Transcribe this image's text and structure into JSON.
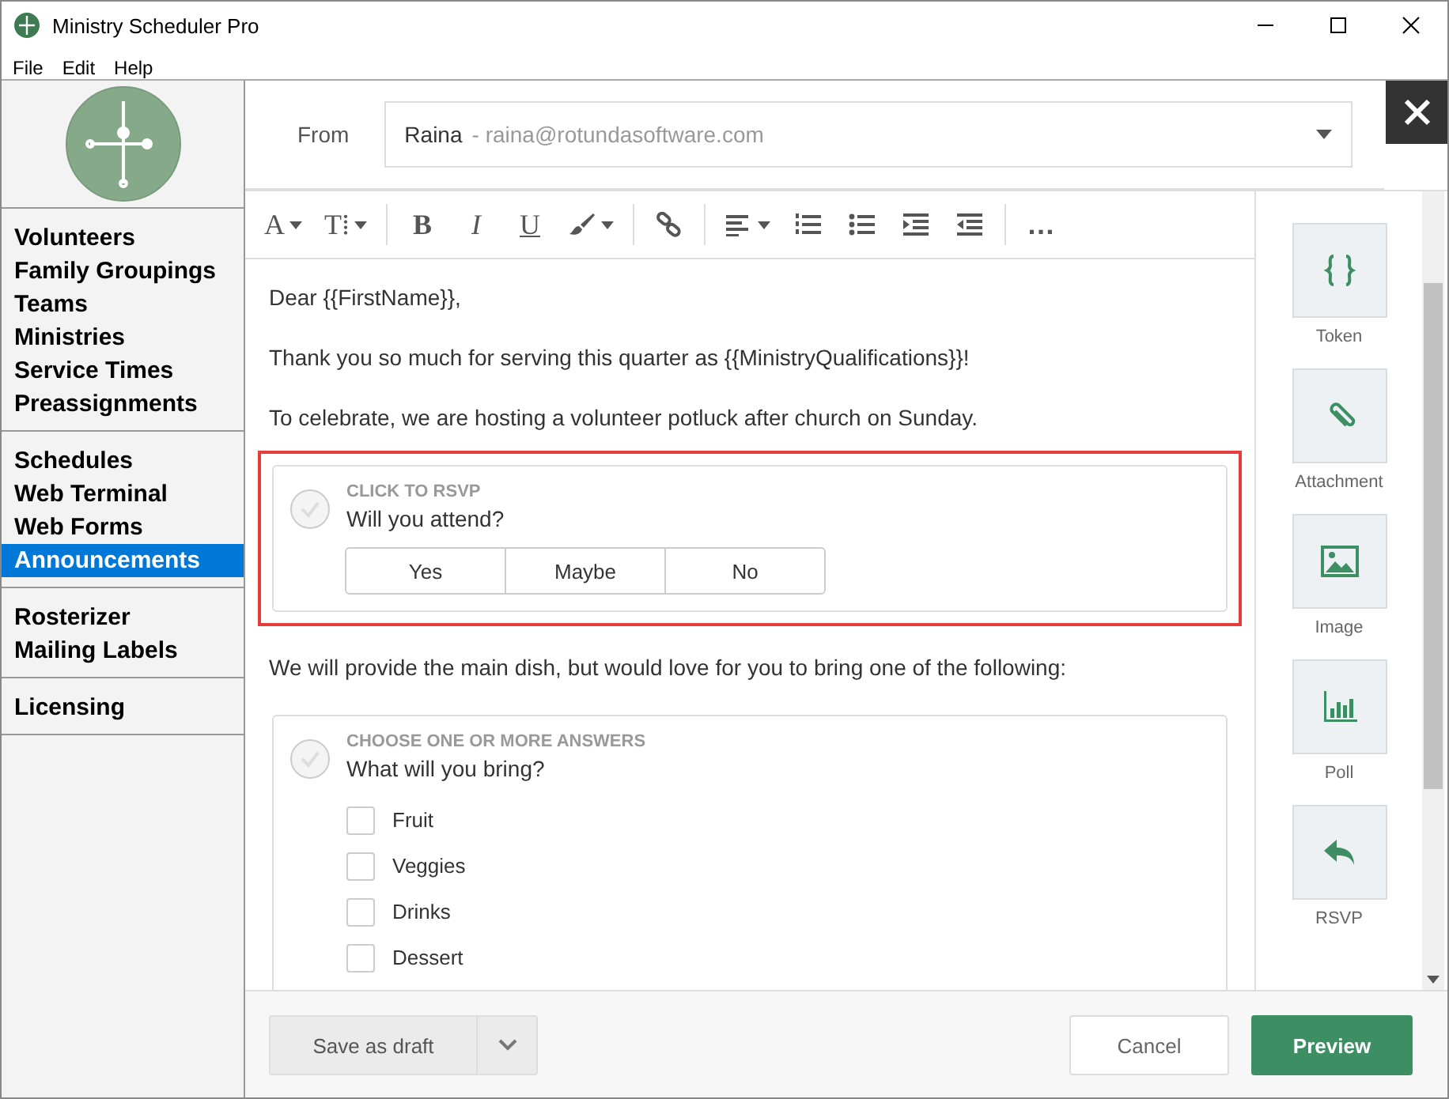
{
  "window": {
    "title": "Ministry Scheduler Pro"
  },
  "menu": [
    "File",
    "Edit",
    "Help"
  ],
  "sidebar": {
    "groups": [
      {
        "items": [
          {
            "label": "Volunteers",
            "selected": false
          },
          {
            "label": "Family Groupings",
            "selected": false
          },
          {
            "label": "Teams",
            "selected": false
          },
          {
            "label": "Ministries",
            "selected": false
          },
          {
            "label": "Service Times",
            "selected": false
          },
          {
            "label": "Preassignments",
            "selected": false
          }
        ]
      },
      {
        "items": [
          {
            "label": "Schedules",
            "selected": false
          },
          {
            "label": "Web Terminal",
            "selected": false
          },
          {
            "label": "Web Forms",
            "selected": false
          },
          {
            "label": "Announcements",
            "selected": true
          }
        ]
      },
      {
        "items": [
          {
            "label": "Rosterizer",
            "selected": false
          },
          {
            "label": "Mailing Labels",
            "selected": false
          }
        ]
      },
      {
        "items": [
          {
            "label": "Licensing",
            "selected": false
          }
        ]
      }
    ]
  },
  "from": {
    "label": "From",
    "name": "Raina",
    "email": "- raina@rotundasoftware.com"
  },
  "toolbar": [
    {
      "kind": "font",
      "glyph": "A"
    },
    {
      "kind": "size",
      "glyph": "T⁞"
    },
    {
      "kind": "sep"
    },
    {
      "kind": "bold",
      "glyph": "B"
    },
    {
      "kind": "italic",
      "glyph": "I"
    },
    {
      "kind": "underline",
      "glyph": "U"
    },
    {
      "kind": "brush"
    },
    {
      "kind": "sep"
    },
    {
      "kind": "link"
    },
    {
      "kind": "sep"
    },
    {
      "kind": "align"
    },
    {
      "kind": "ol"
    },
    {
      "kind": "ul"
    },
    {
      "kind": "indent"
    },
    {
      "kind": "outdent"
    },
    {
      "kind": "sep"
    },
    {
      "kind": "more",
      "glyph": "…"
    }
  ],
  "body": [
    {
      "kind": "text",
      "text": "Dear {{FirstName}},"
    },
    {
      "kind": "text",
      "text": "Thank you so much for serving this quarter as {{MinistryQualifications}}!"
    },
    {
      "kind": "text",
      "text": "To celebrate, we are hosting a volunteer potluck after church on Sunday."
    },
    {
      "kind": "choice",
      "selected": true,
      "caption": "CLICK TO RSVP",
      "question": "Will you attend?",
      "options": [
        "Yes",
        "Maybe",
        "No"
      ]
    },
    {
      "kind": "text",
      "text": "We will provide the main dish, but would love for you to bring one of the following:"
    },
    {
      "kind": "multi",
      "selected": false,
      "caption": "CHOOSE ONE OR MORE ANSWERS",
      "question": "What will you bring?",
      "answers": [
        {
          "label": "Fruit",
          "checked": false
        },
        {
          "label": "Veggies",
          "checked": false
        },
        {
          "label": "Drinks",
          "checked": false
        },
        {
          "label": "Dessert",
          "checked": false
        }
      ]
    }
  ],
  "tools": [
    {
      "kind": "token",
      "label": "Token"
    },
    {
      "kind": "attachment",
      "label": "Attachment"
    },
    {
      "kind": "image",
      "label": "Image"
    },
    {
      "kind": "poll",
      "label": "Poll"
    },
    {
      "kind": "rsvp",
      "label": "RSVP"
    }
  ],
  "footer": {
    "draft": "Save as draft",
    "cancel": "Cancel",
    "preview": "Preview"
  }
}
